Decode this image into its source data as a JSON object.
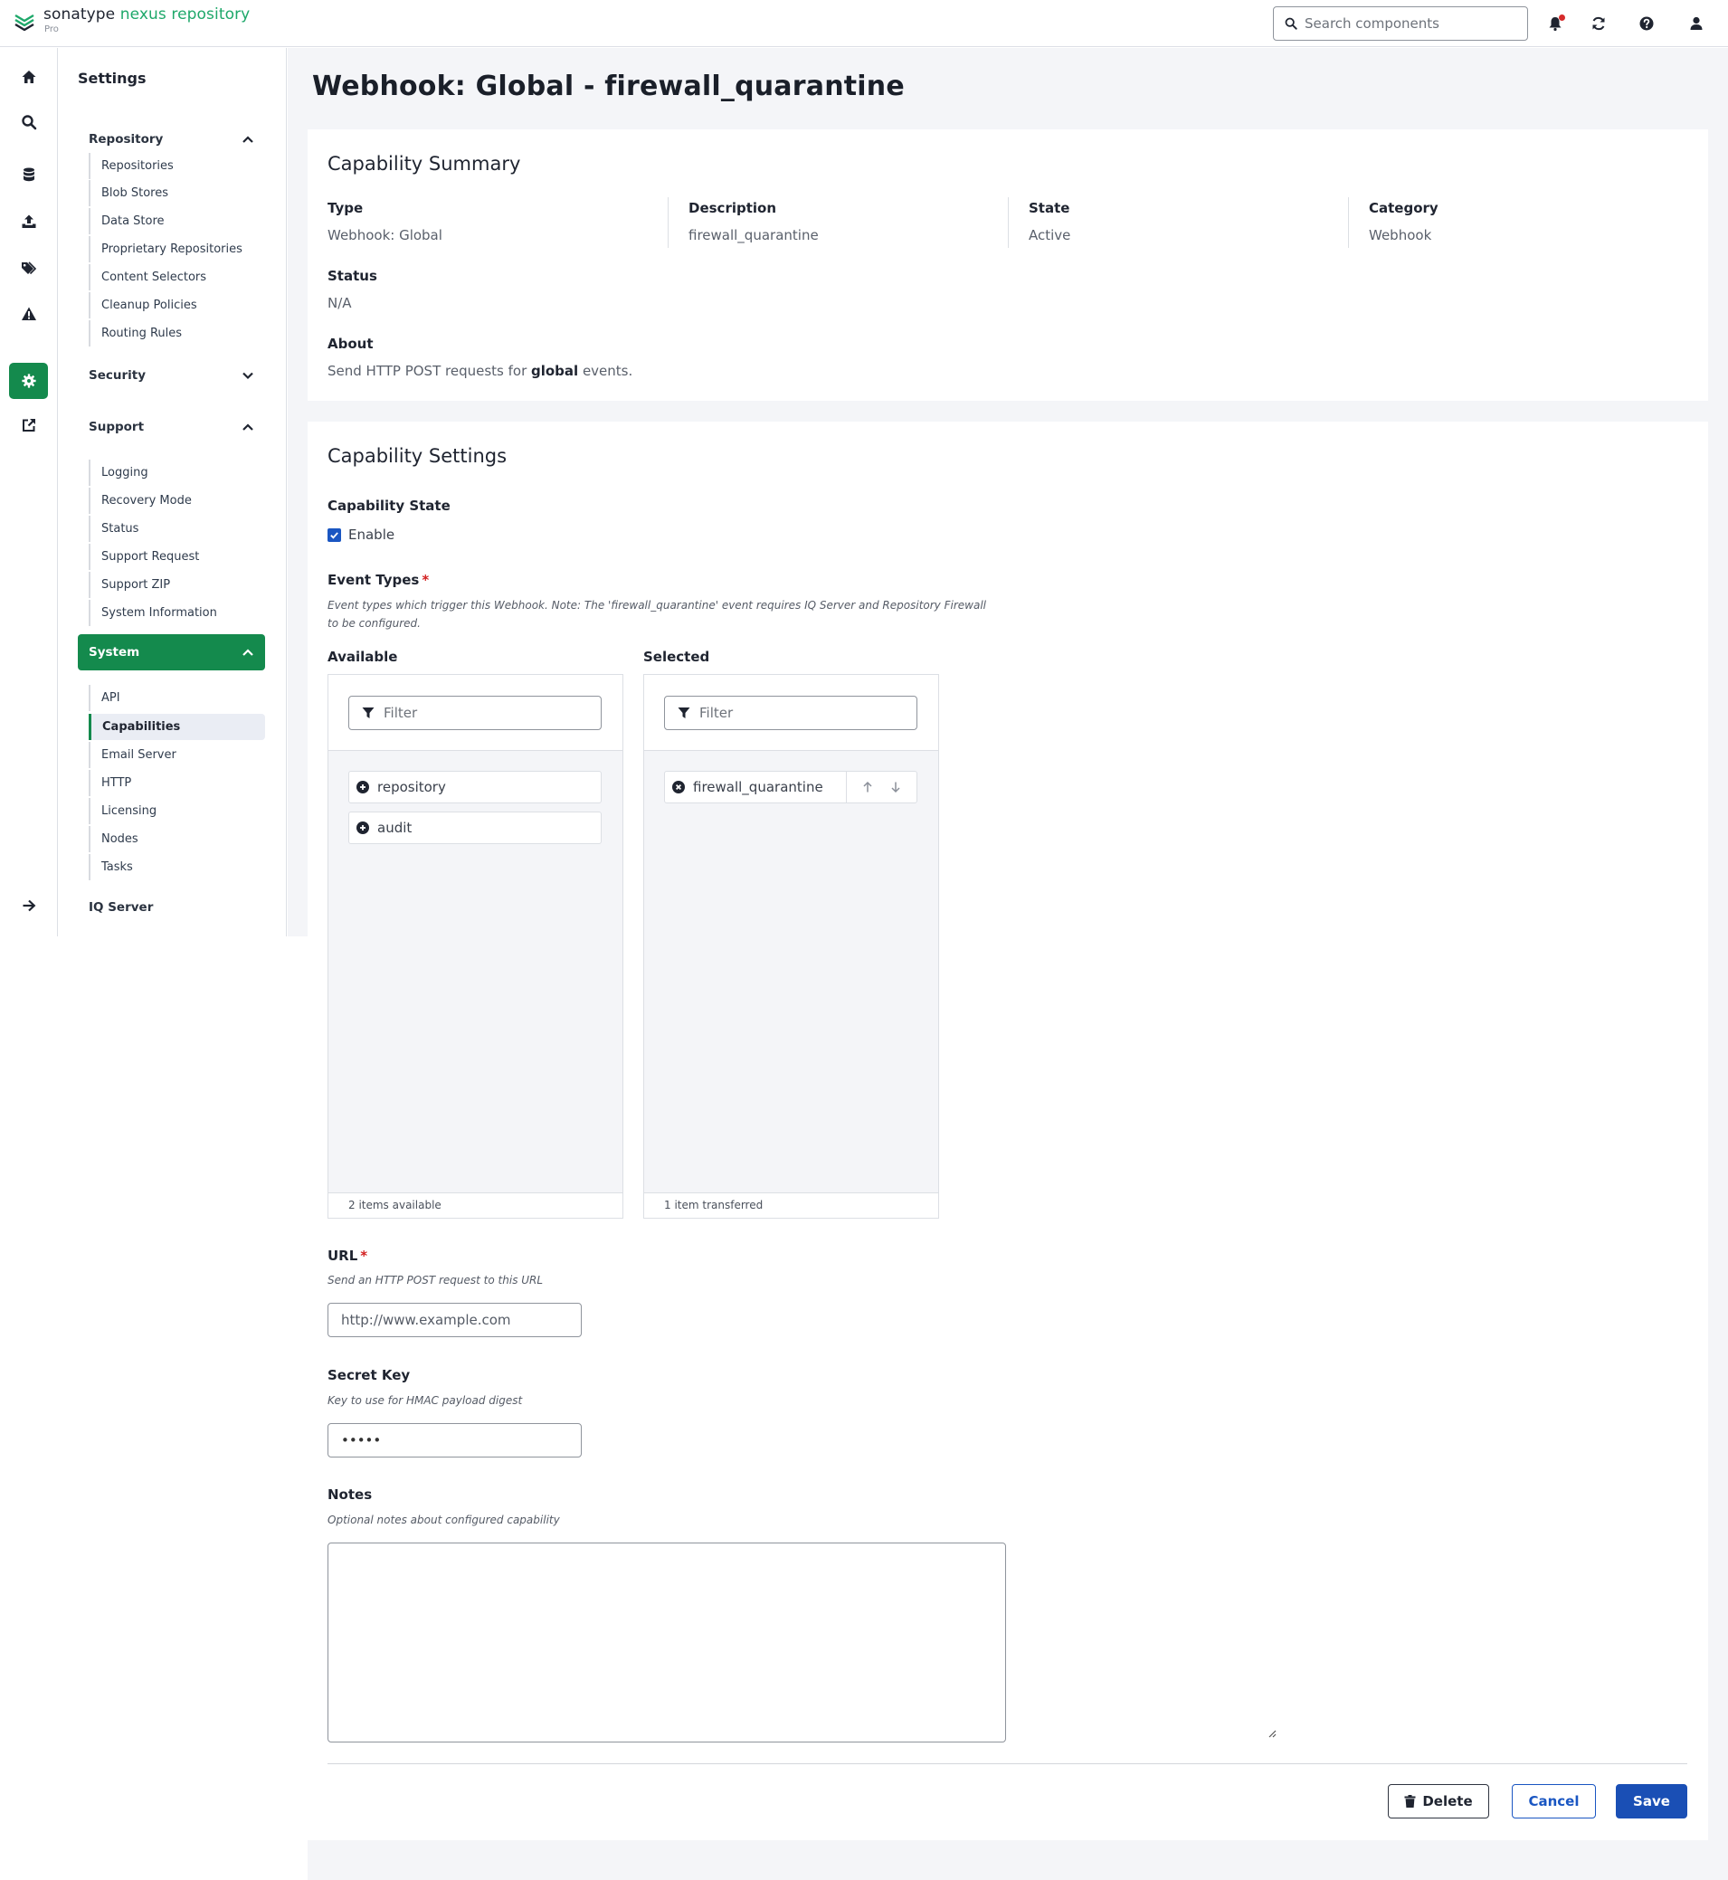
{
  "header": {
    "brand": "sonatype",
    "product": "nexus repository",
    "edition": "Pro",
    "search_placeholder": "Search components",
    "icons": [
      "bell-icon",
      "refresh-icon",
      "help-icon",
      "user-icon"
    ]
  },
  "rail": {
    "icons": [
      "home-icon",
      "search-icon",
      "database-icon",
      "upload-icon",
      "tag-icon",
      "warning-icon",
      "settings-icon",
      "external-link-icon",
      "arrow-right-icon"
    ],
    "active": "settings-icon",
    "accent_color": "#148a4d"
  },
  "nav": {
    "title": "Settings",
    "repository": {
      "label": "Repository",
      "items": [
        "Repositories",
        "Blob Stores",
        "Data Store",
        "Proprietary Repositories",
        "Content Selectors",
        "Cleanup Policies",
        "Routing Rules"
      ]
    },
    "security": {
      "label": "Security"
    },
    "support": {
      "label": "Support",
      "items": [
        "Logging",
        "Recovery Mode",
        "Status",
        "Support Request",
        "Support ZIP",
        "System Information"
      ]
    },
    "system": {
      "label": "System",
      "items": [
        "API",
        "Capabilities",
        "Email Server",
        "HTTP",
        "Licensing",
        "Nodes",
        "Tasks"
      ],
      "active_item": "Capabilities"
    },
    "iq_server": "IQ Server"
  },
  "page": {
    "title": "Webhook: Global - firewall_quarantine"
  },
  "summary": {
    "title": "Capability Summary",
    "type_label": "Type",
    "type_value": "Webhook: Global",
    "description_label": "Description",
    "description_value": "firewall_quarantine",
    "state_label": "State",
    "state_value": "Active",
    "category_label": "Category",
    "category_value": "Webhook",
    "status_label": "Status",
    "status_value": "N/A",
    "about_label": "About",
    "about_prefix": "Send HTTP POST requests for ",
    "about_bold": "global",
    "about_suffix": " events."
  },
  "settings": {
    "title": "Capability Settings",
    "state_label": "Capability State",
    "enable_label": "Enable",
    "enabled": true,
    "event_types_label": "Event Types",
    "event_types_help": "Event types which trigger this Webhook. Note: The 'firewall_quarantine' event requires IQ Server and Repository Firewall to be configured.",
    "available_label": "Available",
    "selected_label": "Selected",
    "filter_placeholder": "Filter",
    "available_items": [
      "repository",
      "audit"
    ],
    "selected_items": [
      "firewall_quarantine"
    ],
    "available_footer": "2 items available",
    "selected_footer": "1 item transferred",
    "url_label": "URL",
    "url_help": "Send an HTTP POST request to this URL",
    "url_placeholder": "http://www.example.com",
    "secret_label": "Secret Key",
    "secret_help": "Key to use for HMAC payload digest",
    "secret_value": "•••••",
    "notes_label": "Notes",
    "notes_help": "Optional notes about configured capability",
    "notes_value": ""
  },
  "actions": {
    "delete_label": "Delete",
    "cancel_label": "Cancel",
    "save_label": "Save",
    "primary_color": "#1a4fb5"
  }
}
